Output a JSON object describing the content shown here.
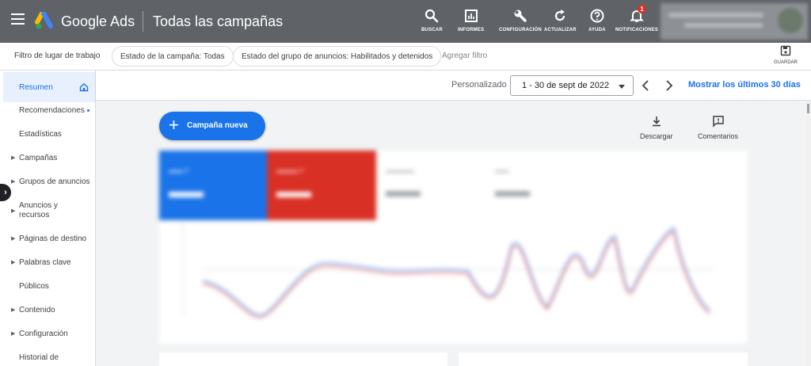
{
  "topbar": {
    "brand": "Google Ads",
    "page_title": "Todas las campañas",
    "actions": [
      {
        "label": "BUSCAR",
        "icon": "search-icon"
      },
      {
        "label": "INFORMES",
        "icon": "reports-icon"
      },
      {
        "label": "CONFIGURACIÓN",
        "icon": "wrench-icon"
      },
      {
        "label": "ACTUALIZAR",
        "icon": "refresh-icon"
      },
      {
        "label": "AYUDA",
        "icon": "help-icon"
      },
      {
        "label": "NOTIFICACIONES",
        "icon": "bell-icon"
      }
    ],
    "notification_count": "1"
  },
  "filterbar": {
    "workspace_label": "Filtro de lugar de trabajo",
    "chips": [
      "Estado de la campaña: Todas",
      "Estado del grupo de anuncios: Habilitados y detenidos"
    ],
    "add_filter": "Agregar filtro",
    "save_label": "GUARDAR"
  },
  "sidebar": {
    "items": [
      {
        "label": "Resumen",
        "active": true
      },
      {
        "label": "Recomendaciones",
        "dot": true
      },
      {
        "label": "Estadísticas"
      },
      {
        "label": "Campañas",
        "caret": true
      },
      {
        "label": "Grupos de anuncios",
        "caret": true
      },
      {
        "label": "Anuncios y recursos",
        "caret": true
      },
      {
        "label": "Páginas de destino",
        "caret": true
      },
      {
        "label": "Palabras clave",
        "caret": true
      },
      {
        "label": "Públicos"
      },
      {
        "label": "Contenido",
        "caret": true
      },
      {
        "label": "Configuración",
        "caret": true
      },
      {
        "label": "Historial de"
      }
    ]
  },
  "datebar": {
    "range_type": "Personalizado",
    "range_value": "1 - 30 de sept de 2022",
    "last_days_link": "Mostrar los últimos 30 días"
  },
  "main": {
    "new_campaign": "Campaña nueva",
    "download": "Descargar",
    "comments": "Comentarios"
  },
  "colors": {
    "topbar": "#5f6368",
    "accent": "#1a73e8",
    "red": "#d93025"
  }
}
